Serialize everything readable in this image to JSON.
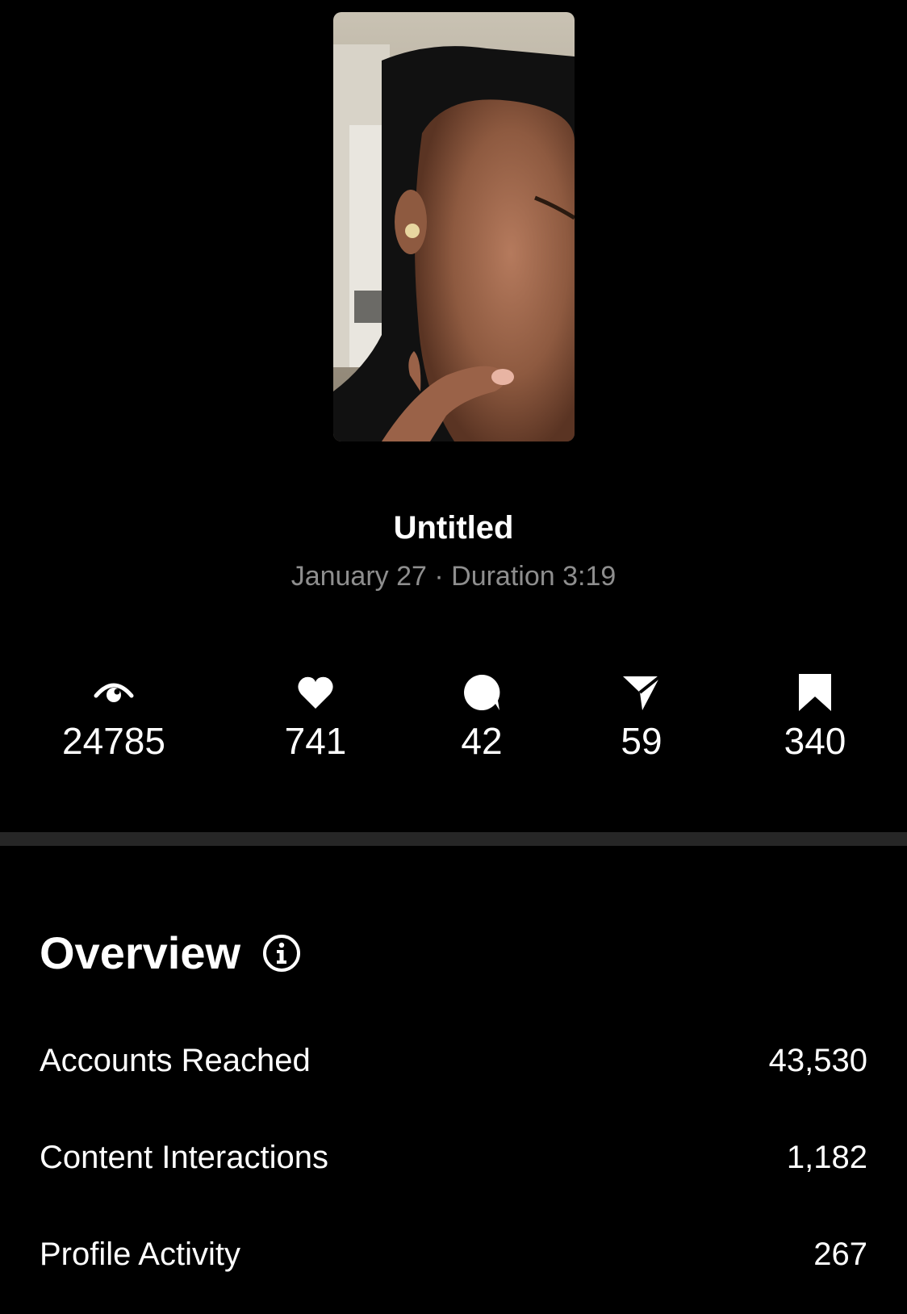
{
  "post": {
    "title": "Untitled",
    "meta": "January 27 · Duration 3:19"
  },
  "metrics": [
    {
      "icon": "eye-icon",
      "value": "24785"
    },
    {
      "icon": "heart-icon",
      "value": "741"
    },
    {
      "icon": "comment-icon",
      "value": "42"
    },
    {
      "icon": "share-icon",
      "value": "59"
    },
    {
      "icon": "bookmark-icon",
      "value": "340"
    }
  ],
  "overview": {
    "title": "Overview",
    "rows": [
      {
        "label": "Accounts Reached",
        "value": "43,530"
      },
      {
        "label": "Content Interactions",
        "value": "1,182"
      },
      {
        "label": "Profile Activity",
        "value": "267"
      }
    ]
  },
  "colors": {
    "background": "#000000",
    "text": "#ffffff",
    "secondary_text": "#8e8e8e",
    "divider": "#262626"
  }
}
